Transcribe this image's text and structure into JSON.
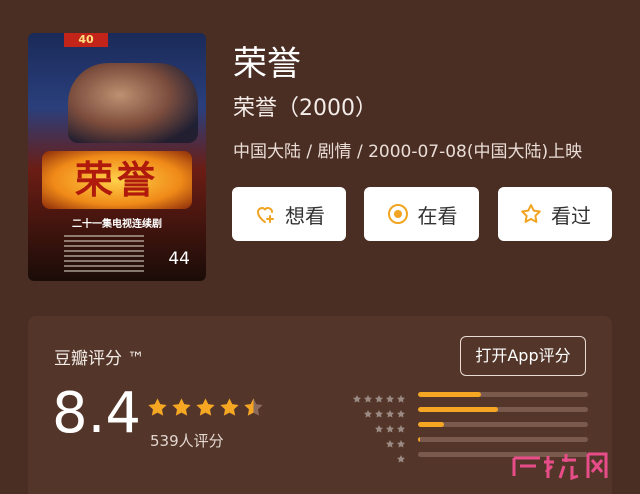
{
  "movie": {
    "title": "荣誉",
    "subtitle": "荣誉（2000）",
    "meta": "中国大陆 / 剧情 / 2000-07-08(中国大陆)上映",
    "poster": {
      "logo_text": "荣誉",
      "subline": "二十一集电视连续剧",
      "episode_count": "44"
    }
  },
  "actions": [
    {
      "label": "想看",
      "icon": "heart-plus-icon"
    },
    {
      "label": "在看",
      "icon": "target-dot-icon"
    },
    {
      "label": "看过",
      "icon": "star-outline-icon"
    }
  ],
  "rating": {
    "label": "豆瓣评分 ™",
    "app_button": "打开App评分",
    "score": "8.4",
    "stars": 4.5,
    "count": "539人评分",
    "distribution": [
      {
        "stars": 5,
        "fraction": 0.37
      },
      {
        "stars": 4,
        "fraction": 0.47
      },
      {
        "stars": 3,
        "fraction": 0.15
      },
      {
        "stars": 2,
        "fraction": 0.01
      },
      {
        "stars": 1,
        "fraction": 0.0
      }
    ]
  },
  "colors": {
    "background": "#4a2e24",
    "card": "#533629",
    "star": "#f5a623",
    "icon_accent": "#f0a422"
  },
  "watermark": "广西龙网"
}
